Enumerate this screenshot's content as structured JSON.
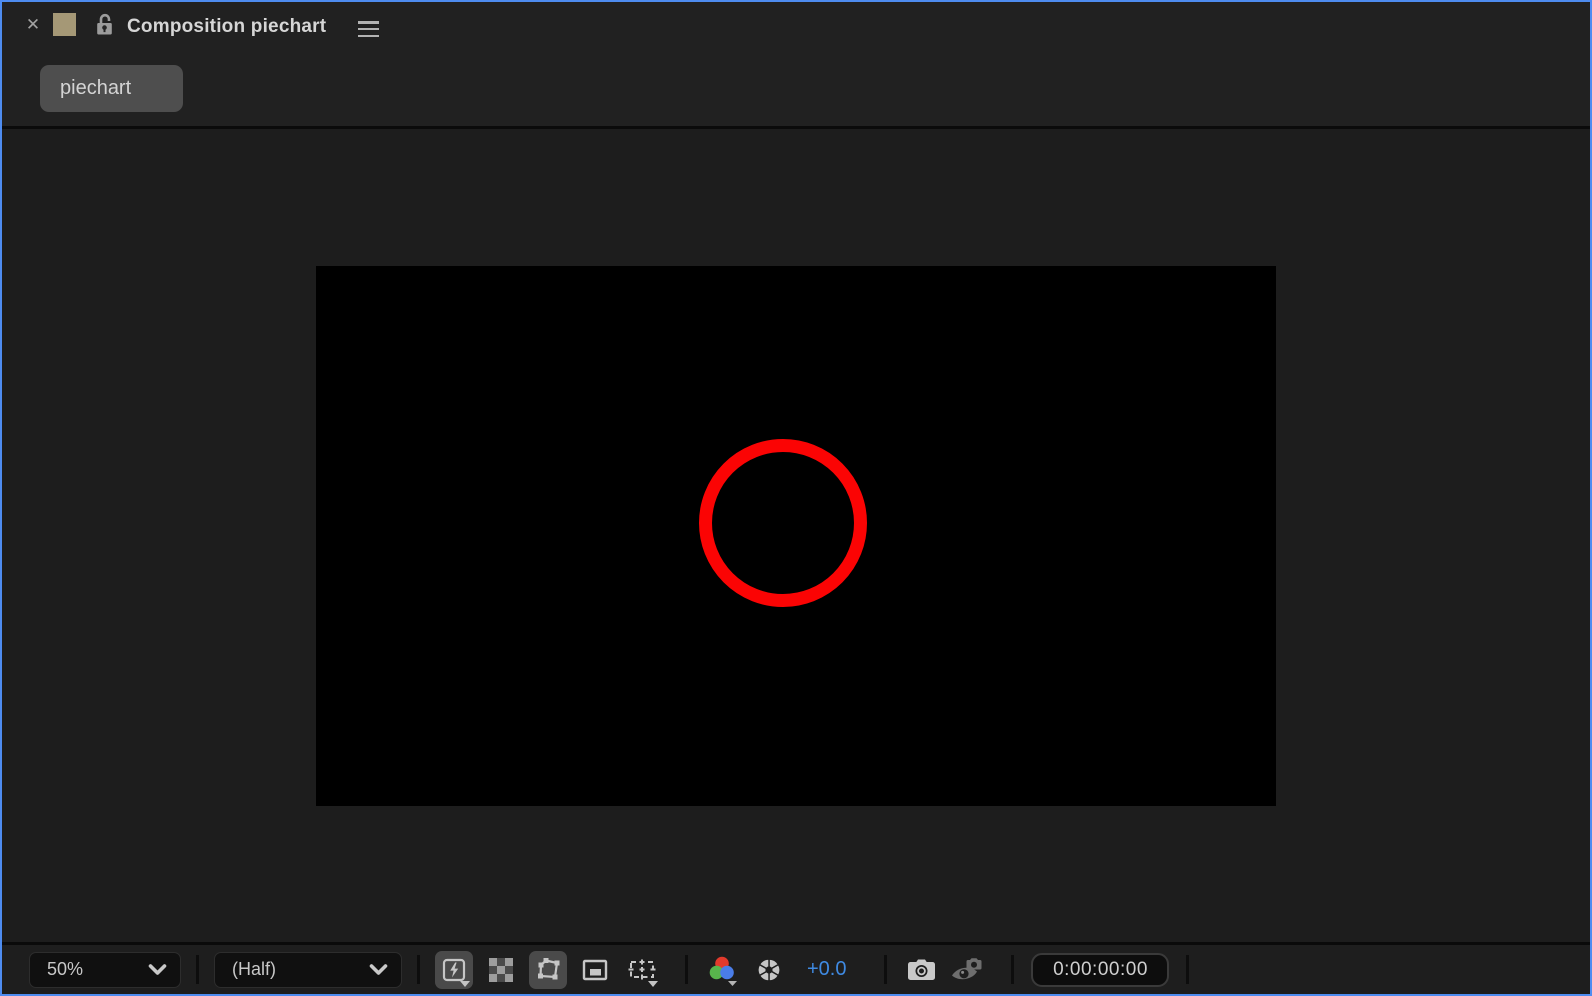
{
  "colors": {
    "focus_border": "#4e8cf0",
    "tan_chip": "#a59876",
    "exposure_blue": "#3f8ae2",
    "circle_red": "#fb0404",
    "rgb_red": "#e23a2c",
    "rgb_green": "#58b54c",
    "rgb_blue": "#4a7de8"
  },
  "icons": {
    "close_glyph": "✕"
  },
  "header": {
    "title": "Composition piechart",
    "tab_label": "piechart"
  },
  "toolbar": {
    "magnification": {
      "value": "50%"
    },
    "resolution": {
      "value": "(Half)"
    },
    "exposure": {
      "value": "+0.0"
    },
    "timecode": {
      "value": "0:00:00:00"
    }
  }
}
